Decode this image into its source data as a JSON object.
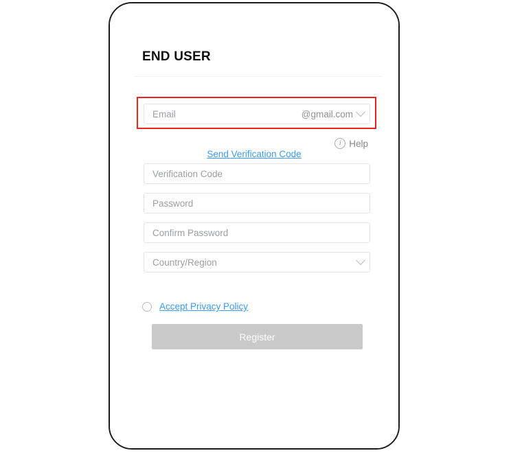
{
  "page": {
    "title": "END USER"
  },
  "email": {
    "placeholder": "Email",
    "value": "",
    "domain_suffix": "@gmail.com",
    "required_marker": "*",
    "dropdown_icon": "chevron-down-icon",
    "highlighted": true,
    "highlight_color": "#ee2222"
  },
  "help": {
    "icon": "info-circle-icon",
    "label": "Help"
  },
  "send_code": {
    "label": "Send Verification Code",
    "color": "#3b9bf0"
  },
  "fields": [
    {
      "name": "verification-code",
      "placeholder": "Verification Code",
      "value": "",
      "required_marker": "*",
      "type": "text"
    },
    {
      "name": "password",
      "placeholder": "Password",
      "value": "",
      "required_marker": "*",
      "type": "password"
    },
    {
      "name": "confirm-password",
      "placeholder": "Confirm Password",
      "value": "",
      "required_marker": "*",
      "type": "password"
    },
    {
      "name": "country-region",
      "placeholder": "Country/Region",
      "value": "",
      "required_marker": "*",
      "type": "select",
      "dropdown_icon": "chevron-down-icon"
    }
  ],
  "privacy": {
    "checkbox_state": "unchecked",
    "label": "Accept Privacy Policy",
    "color": "#3b9bf0"
  },
  "register": {
    "label": "Register",
    "enabled": false,
    "background": "#c9c9c9",
    "text_color": "#ffffff"
  },
  "colors": {
    "required_star": "#f04b52",
    "link": "#3b9bf0",
    "placeholder": "#9b9ea3",
    "frame_border": "#1b1b1b"
  }
}
